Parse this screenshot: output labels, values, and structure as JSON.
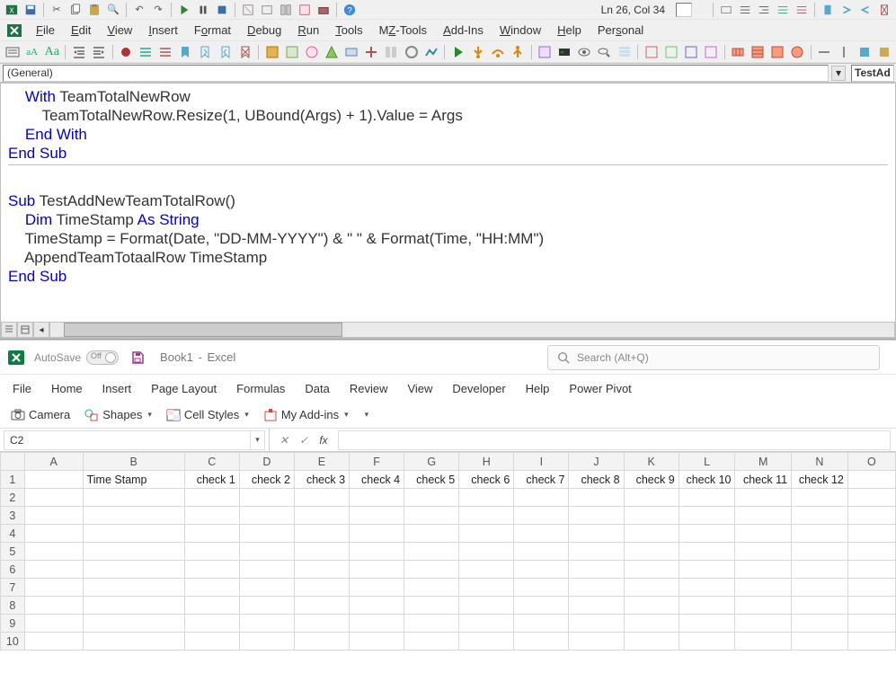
{
  "vba": {
    "status": "Ln 26, Col 34",
    "menus": [
      "File",
      "Edit",
      "View",
      "Insert",
      "Format",
      "Debug",
      "Run",
      "Tools",
      "MZ-Tools",
      "Add-Ins",
      "Window",
      "Help",
      "Personal"
    ],
    "dd_left": "(General)",
    "dd_right": "TestAd",
    "code_lines": [
      {
        "t": "    With TeamTotalNewRow",
        "kw": [
          "With"
        ]
      },
      {
        "t": "        TeamTotalNewRow.Resize(1, UBound(Args) + 1).Value = Args",
        "kw": []
      },
      {
        "t": "    End With",
        "kw": [
          "End",
          "With"
        ]
      },
      {
        "t": "End Sub",
        "kw": [
          "End",
          "Sub"
        ]
      },
      {
        "t": "",
        "kw": []
      },
      {
        "t": "Sub TestAddNewTeamTotalRow()",
        "kw": [
          "Sub"
        ]
      },
      {
        "t": "    Dim TimeStamp As String",
        "kw": [
          "Dim",
          "As",
          "String"
        ]
      },
      {
        "t": "    TimeStamp = Format(Date, \"DD-MM-YYYY\") & \" \" & Format(Time, \"HH:MM\")",
        "kw": []
      },
      {
        "t": "    AppendTeamTotaalRow TimeStamp",
        "kw": []
      },
      {
        "t": "End Sub",
        "kw": [
          "End",
          "Sub"
        ]
      }
    ]
  },
  "excel": {
    "autosave": "AutoSave",
    "toggle_off": "Off",
    "doc_name": "Book1",
    "app_name": "Excel",
    "search_placeholder": "Search (Alt+Q)",
    "tabs": [
      "File",
      "Home",
      "Insert",
      "Page Layout",
      "Formulas",
      "Data",
      "Review",
      "View",
      "Developer",
      "Help",
      "Power Pivot"
    ],
    "quick": {
      "camera": "Camera",
      "shapes": "Shapes",
      "cellstyles": "Cell Styles",
      "myaddins": "My Add-ins"
    },
    "namebox": "C2",
    "fx_label": "fx",
    "columns": [
      "A",
      "B",
      "C",
      "D",
      "E",
      "F",
      "G",
      "H",
      "I",
      "J",
      "K",
      "L",
      "M",
      "N",
      "O"
    ],
    "rows": [
      1,
      2,
      3,
      4,
      5,
      6,
      7,
      8,
      9,
      10
    ],
    "row1": {
      "B": "Time Stamp",
      "C": "check 1",
      "D": "check 2",
      "E": "check 3",
      "F": "check 4",
      "G": "check 5",
      "H": "check 6",
      "I": "check 7",
      "J": "check 8",
      "K": "check 9",
      "L": "check 10",
      "M": "check 11",
      "N": "check 12"
    }
  }
}
